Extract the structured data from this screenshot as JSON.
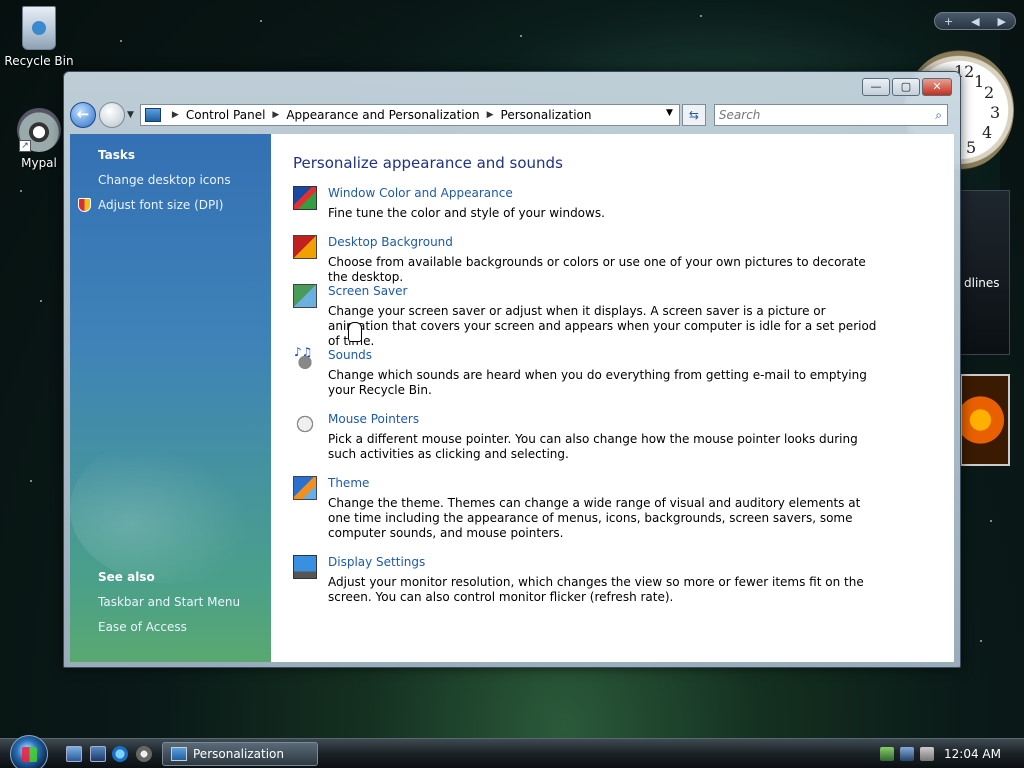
{
  "desktop": {
    "icons": [
      {
        "label": "Recycle Bin"
      },
      {
        "label": "Mypal"
      }
    ],
    "gadgets": {
      "sidebar_controls": {
        "add": "+",
        "prev": "◀",
        "next": "▶"
      },
      "clock_numbers": [
        "12",
        "1",
        "2",
        "3",
        "4",
        "5"
      ],
      "feed_text": "dlines"
    }
  },
  "window": {
    "controls": {
      "minimize": "—",
      "maximize": "▢",
      "close": "✕"
    },
    "address": {
      "crumbs": [
        "Control Panel",
        "Appearance and Personalization",
        "Personalization"
      ],
      "separator": "▶",
      "dropdown": "▼",
      "refresh": "⇆"
    },
    "search": {
      "placeholder": "Search",
      "icon": "⌕"
    },
    "left_pane": {
      "tasks_heading": "Tasks",
      "tasks": [
        "Change desktop icons",
        "Adjust font size (DPI)"
      ],
      "see_also_heading": "See also",
      "see_also": [
        "Taskbar and Start Menu",
        "Ease of Access"
      ]
    },
    "content": {
      "heading": "Personalize appearance and sounds",
      "items": [
        {
          "icon": "window-color-icon",
          "title": "Window Color and Appearance",
          "desc": "Fine tune the color and style of your windows."
        },
        {
          "icon": "desktop-background-icon",
          "title": "Desktop Background",
          "desc": "Choose from available backgrounds or colors or use one of your own pictures to decorate the desktop."
        },
        {
          "icon": "screen-saver-icon",
          "title": "Screen Saver",
          "desc": "Change your screen saver or adjust when it displays. A screen saver is a picture or animation that covers your screen and appears when your computer is idle for a set period of time."
        },
        {
          "icon": "sounds-icon",
          "title": "Sounds",
          "desc": "Change which sounds are heard when you do everything from getting e-mail to emptying your Recycle Bin."
        },
        {
          "icon": "mouse-icon",
          "title": "Mouse Pointers",
          "desc": "Pick a different mouse pointer. You can also change how the mouse pointer looks during such activities as clicking and selecting."
        },
        {
          "icon": "theme-icon",
          "title": "Theme",
          "desc": "Change the theme. Themes can change a wide range of visual and auditory elements at one time including the appearance of menus, icons, backgrounds, screen savers, some computer sounds, and mouse pointers."
        },
        {
          "icon": "display-settings-icon",
          "title": "Display Settings",
          "desc": "Adjust your monitor resolution, which changes the view so more or fewer items fit on the screen. You can also control monitor flicker (refresh rate)."
        }
      ]
    }
  },
  "taskbar": {
    "task_button_label": "Personalization",
    "time": "12:04 AM"
  }
}
